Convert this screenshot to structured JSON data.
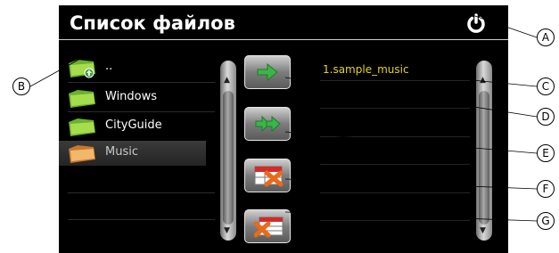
{
  "window": {
    "title": "Список файлов"
  },
  "folders": [
    {
      "label": "..",
      "icon": "folder-up-icon"
    },
    {
      "label": "Windows",
      "icon": "folder-icon"
    },
    {
      "label": "CityGuide",
      "icon": "folder-icon"
    },
    {
      "label": "Music",
      "icon": "folder-icon",
      "selected": true
    }
  ],
  "files": [
    {
      "label": "1.sample_music"
    }
  ],
  "buttons": [
    {
      "name": "add-file-button",
      "icon": "green-arrow-icon"
    },
    {
      "name": "add-all-button",
      "icon": "double-green-arrow-icon"
    },
    {
      "name": "remove-file-button",
      "icon": "delete-icon"
    },
    {
      "name": "remove-all-button",
      "icon": "delete-all-icon"
    }
  ],
  "callouts": [
    "A",
    "B",
    "C",
    "D",
    "E",
    "F",
    "G"
  ],
  "colors": {
    "background": "#000000",
    "file_text": "#e6d21c",
    "arrow_green": "#3ab54a",
    "delete_orange": "#e86a1a"
  }
}
